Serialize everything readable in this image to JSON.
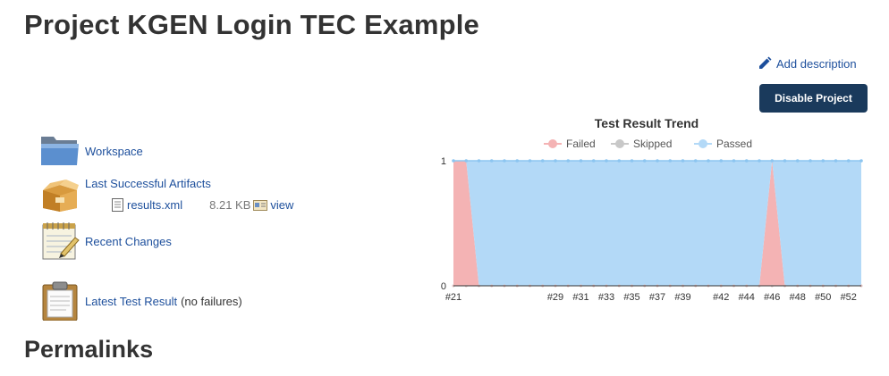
{
  "page": {
    "title": "Project KGEN Login TEC Example",
    "permalinks_heading": "Permalinks"
  },
  "actions": {
    "add_description": "Add description",
    "disable_project": "Disable Project"
  },
  "tasks": {
    "workspace": {
      "label": "Workspace",
      "icon": "folder-icon"
    },
    "artifacts": {
      "label": "Last Successful Artifacts",
      "icon": "package-box-icon",
      "file": {
        "name": "results.xml",
        "size": "8.21 KB",
        "view_label": "view",
        "icon": "document-icon",
        "view_icon": "fingerprint-icon"
      }
    },
    "recent_changes": {
      "label": "Recent Changes",
      "icon": "notepad-icon"
    },
    "latest_test": {
      "label": "Latest Test Result",
      "suffix": "(no failures)",
      "icon": "clipboard-icon"
    }
  },
  "colors": {
    "failed": "#f4b3b4",
    "skipped": "#c8c8c8",
    "passed": "#b3d9f7",
    "link": "#1d4f9c",
    "button": "#1a3a5c"
  },
  "chart_data": {
    "type": "area",
    "title": "Test Result Trend",
    "legend": [
      "Failed",
      "Skipped",
      "Passed"
    ],
    "legend_position": "top",
    "stacked": true,
    "x_tick_labels": [
      "#21",
      "#29",
      "#31",
      "#33",
      "#35",
      "#37",
      "#39",
      "#42",
      "#44",
      "#46",
      "#48",
      "#50",
      "#52"
    ],
    "y_tick_labels": [
      "0",
      "1"
    ],
    "ylim": [
      0,
      1
    ],
    "x": [
      "#21",
      "#22",
      "#23",
      "#24",
      "#25",
      "#26",
      "#27",
      "#28",
      "#29",
      "#30",
      "#31",
      "#32",
      "#33",
      "#34",
      "#35",
      "#36",
      "#37",
      "#38",
      "#39",
      "#40",
      "#41",
      "#42",
      "#43",
      "#44",
      "#45",
      "#46",
      "#47",
      "#48",
      "#49",
      "#50",
      "#51",
      "#52",
      "#53"
    ],
    "series": [
      {
        "name": "Failed",
        "values": [
          1,
          1,
          0,
          0,
          0,
          0,
          0,
          0,
          0,
          0,
          0,
          0,
          0,
          0,
          0,
          0,
          0,
          0,
          0,
          0,
          0,
          0,
          0,
          0,
          0,
          1,
          0,
          0,
          0,
          0,
          0,
          0,
          0
        ]
      },
      {
        "name": "Skipped",
        "values": [
          0,
          0,
          0,
          0,
          0,
          0,
          0,
          0,
          0,
          0,
          0,
          0,
          0,
          0,
          0,
          0,
          0,
          0,
          0,
          0,
          0,
          0,
          0,
          0,
          0,
          0,
          0,
          0,
          0,
          0,
          0,
          0,
          0
        ]
      },
      {
        "name": "Passed",
        "values": [
          0,
          0,
          1,
          1,
          1,
          1,
          1,
          1,
          1,
          1,
          1,
          1,
          1,
          1,
          1,
          1,
          1,
          1,
          1,
          1,
          1,
          1,
          1,
          1,
          1,
          0,
          1,
          1,
          1,
          1,
          1,
          1,
          1
        ]
      }
    ]
  }
}
